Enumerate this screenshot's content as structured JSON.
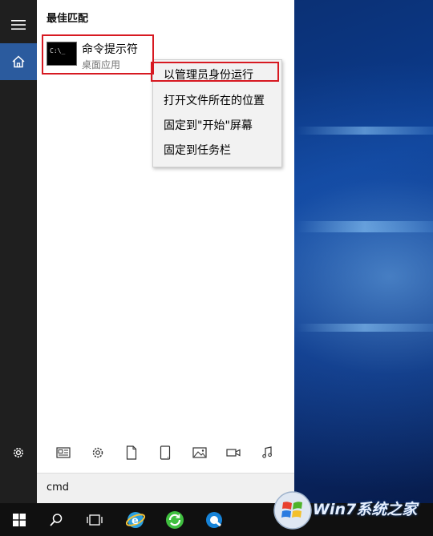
{
  "start_menu": {
    "section_title": "最佳匹配",
    "best_match": {
      "tile_text": "C:\\_",
      "name": "命令提示符",
      "type": "桌面应用"
    }
  },
  "context_menu": {
    "items": [
      {
        "label": "以管理员身份运行"
      },
      {
        "label": "打开文件所在的位置"
      },
      {
        "label": "固定到\"开始\"屏幕"
      },
      {
        "label": "固定到任务栏"
      }
    ]
  },
  "filters": [
    "news-icon",
    "settings-icon",
    "document-icon",
    "tablet-icon",
    "photo-icon",
    "video-icon",
    "music-icon"
  ],
  "search": {
    "value": "cmd"
  },
  "watermark": {
    "text": "Win7系统之家"
  },
  "colors": {
    "accent": "#2b5b9e",
    "highlight_box": "#d71921",
    "taskbar": "#101010"
  }
}
